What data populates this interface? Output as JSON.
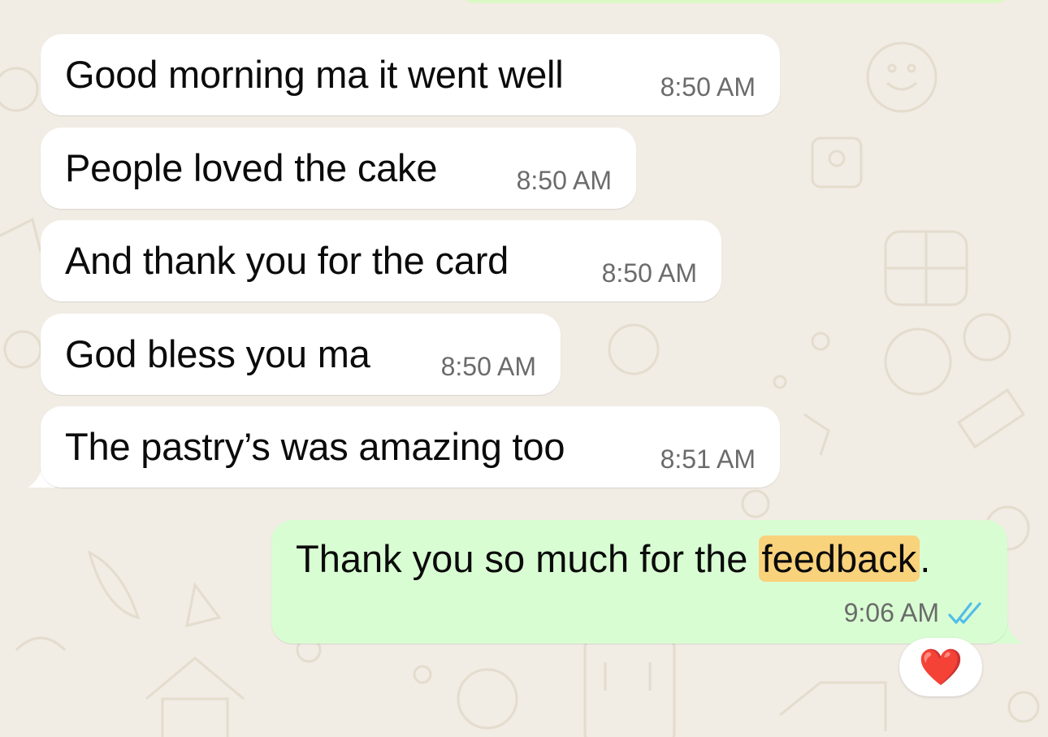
{
  "incoming_messages": [
    {
      "text": "Good morning ma it went well",
      "time": "8:50 AM"
    },
    {
      "text": "People loved the cake",
      "time": "8:50 AM"
    },
    {
      "text": "And thank you for the card",
      "time": "8:50 AM"
    },
    {
      "text": "God bless you ma",
      "time": "8:50 AM"
    },
    {
      "text": "The pastry’s was amazing too",
      "time": "8:51 AM"
    }
  ],
  "outgoing_message": {
    "text_before": "Thank you so much for the ",
    "highlighted_word": "feedback",
    "text_after": ".",
    "time": "9:06 AM",
    "status_icon": "double-check-read-icon"
  },
  "reaction": {
    "emoji": "❤️",
    "icon": "heart-reaction-icon"
  },
  "colors": {
    "background": "#f1ece4",
    "incoming_bubble": "#ffffff",
    "outgoing_bubble": "#d9fdd3",
    "highlight": "#f9d27c",
    "read_ticks": "#53bdeb",
    "timestamp": "#6b6b6b"
  }
}
